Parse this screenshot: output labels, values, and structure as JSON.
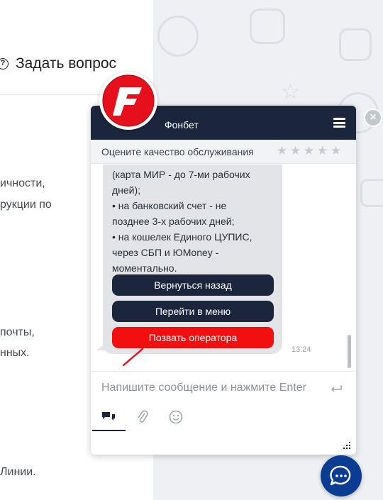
{
  "page": {
    "ask_button_label": "Задать вопрос",
    "lines": [
      "ичности,",
      "рукции по",
      "почты,",
      "нных.",
      "Линии."
    ]
  },
  "chat": {
    "title": "Фонбет",
    "rating_label": "Оцените качество обслуживания",
    "rating_stars": 5,
    "message_lines": [
      "(карта МИР - до 7-ми рабочих",
      "дней);",
      "• на банковский счет - не",
      "позднее 3-х рабочих дней;",
      "• на кошелек Единого ЦУПИС,",
      "через СБП и ЮMoney -",
      "моментально."
    ],
    "buttons": {
      "back": "Вернуться назад",
      "menu": "Перейти в меню",
      "operator": "Позвать оператора"
    },
    "time": "13:24",
    "input_placeholder": "Напишите сообщение и нажмите Enter"
  },
  "colors": {
    "header": "#1b263d",
    "operator_button": "#f20f0f",
    "fab": "#0a3d92",
    "logo_red": "#e5101b"
  },
  "icons": [
    "question-icon",
    "menu-icon",
    "star-icon",
    "enter-icon",
    "chat-icon",
    "paperclip-icon",
    "smiley-icon",
    "close-icon",
    "resize-grip-icon",
    "chat-bubble-icon"
  ]
}
